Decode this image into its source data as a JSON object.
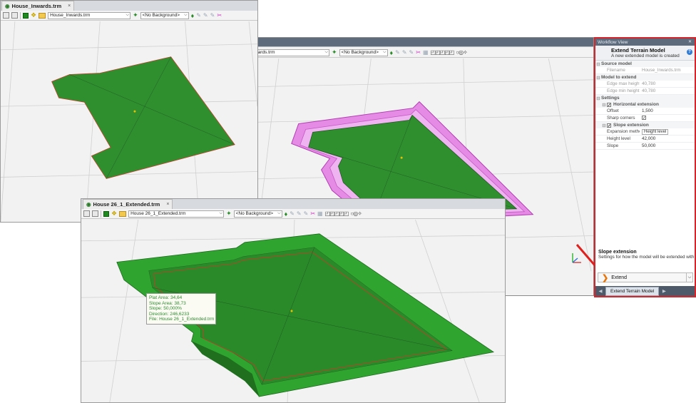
{
  "window1": {
    "tab_title": "House_Inwards.trm",
    "close": "×",
    "file_combo": "House_Inwards.trm",
    "background_combo": "<No Background>"
  },
  "window2": {
    "file_combo": "wards.trm",
    "background_combo": "<No Background>"
  },
  "window3": {
    "tab_title": "House 26_1_Extended.trm",
    "close": "×",
    "file_combo": "House 26_1_Extended.trm",
    "background_combo": "<No Background>"
  },
  "tooltip": {
    "lines": [
      "Plat Area: 34,64",
      "Slope Area: 38,73",
      "Slope: 50,000%",
      "Direction: 246,6233",
      "File: House 26_1_Extended.trm"
    ]
  },
  "workflow": {
    "header": "Workflow View",
    "pin": "✕",
    "title": "Extend Terrain Model",
    "subtitle": "A new extended model is created",
    "help": "?",
    "source_model": {
      "label": "Source model",
      "filename_key": "Filename",
      "filename_value": "House_Inwards.trm"
    },
    "model_to_extend": {
      "label": "Model to extend",
      "edge_max_key": "Edge max height",
      "edge_max_value": "40,780",
      "edge_min_key": "Edge min height",
      "edge_min_value": "40,780"
    },
    "settings": {
      "label": "Settings",
      "horizontal_extension": "Horizontal extension",
      "offset_key": "Offset",
      "offset_value": "1,500",
      "sharp_corners_key": "Sharp corners",
      "slope_extension": "Slope extension",
      "expansion_method_key": "Expansion method",
      "expansion_method_value": "Height level",
      "height_level_key": "Height level",
      "height_level_value": "42,000",
      "slope_key": "Slope",
      "slope_value": "50,000"
    },
    "description": {
      "title": "Slope extension",
      "text": "Settings for how the model will be extended with a"
    },
    "extend_button": "Extend",
    "footer_tab": "Extend Terrain Model"
  },
  "colors": {
    "terrain_green": "#2f8f2f",
    "slope_green": "#3ab93a",
    "extension_magenta": "#e07be0",
    "highlight_border": "#d6242a",
    "arrow_red": "#e0201c"
  }
}
